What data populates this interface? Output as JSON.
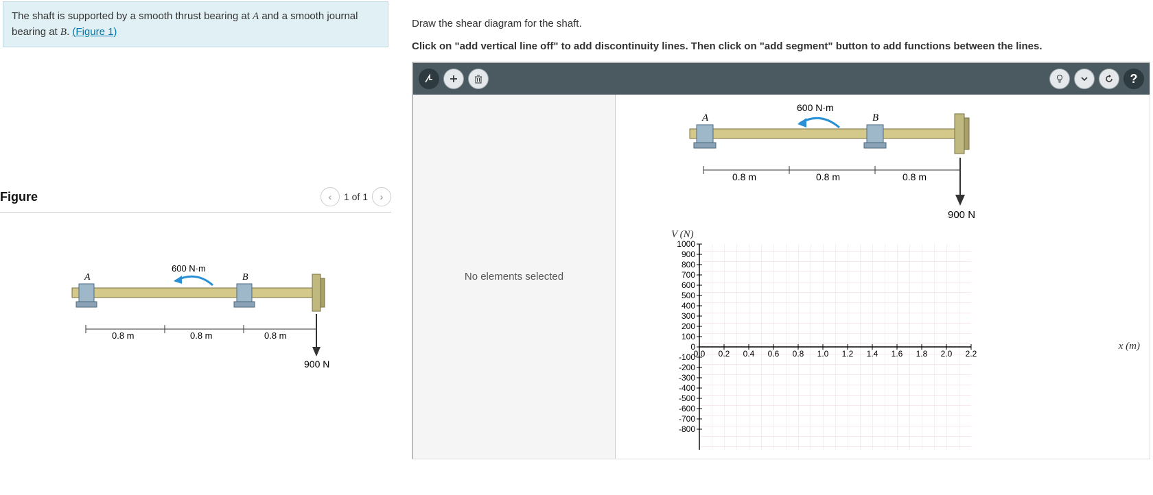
{
  "problem": {
    "text_a": "The shaft is supported by a smooth thrust bearing at ",
    "A": "A",
    "text_b": " and a smooth journal bearing at ",
    "B": "B",
    "text_c": ". ",
    "fig_link": "(Figure 1)"
  },
  "figure": {
    "title": "Figure",
    "pager_label": "1 of 1",
    "moment": "600 N·m",
    "label_A": "A",
    "label_B": "B",
    "d1": "0.8 m",
    "d2": "0.8 m",
    "d3": "0.8 m",
    "load": "900 N"
  },
  "task": {
    "line1": "Draw the shear diagram for the shaft.",
    "line2": "Click on \"add vertical line off\" to add discontinuity lines. Then click on \"add segment\" button to add functions between the lines."
  },
  "toolbar": {
    "add_line": "↯",
    "add_seg": "+",
    "delete": "🗑",
    "hint": "💡",
    "check": "✓",
    "reset": "↻",
    "help": "?"
  },
  "selection": {
    "none": "No elements selected"
  },
  "diagram2": {
    "moment": "600 N·m",
    "label_A": "A",
    "label_B": "B",
    "d1": "0.8 m",
    "d2": "0.8 m",
    "d3": "0.8 m",
    "load": "900 N"
  },
  "chart": {
    "ylabel": "V (N)",
    "xlabel": "x (m)"
  },
  "chart_data": {
    "type": "line",
    "title": "",
    "xlabel": "x (m)",
    "ylabel": "V (N)",
    "xlim": [
      0.0,
      2.2
    ],
    "ylim": [
      -800,
      1000
    ],
    "x_ticks": [
      0.0,
      0.2,
      0.4,
      0.6,
      0.8,
      1.0,
      1.2,
      1.4,
      1.6,
      1.8,
      2.0,
      2.2
    ],
    "y_ticks_pos": [
      0,
      100,
      200,
      300,
      400,
      500,
      600,
      700,
      800,
      900,
      1000
    ],
    "y_ticks_neg": [
      -100,
      -200,
      -300,
      -400,
      -500,
      -600,
      -700,
      -800
    ],
    "series": []
  }
}
